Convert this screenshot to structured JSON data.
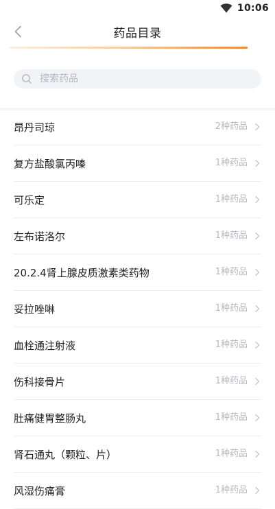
{
  "status_bar": {
    "time": "10:06",
    "icons": [
      "wifi-icon"
    ]
  },
  "header": {
    "title": "药品目录",
    "back_icon": "chevron-left-icon"
  },
  "search": {
    "placeholder": "搜索药品",
    "value": "",
    "icon": "search-icon"
  },
  "colors": {
    "accent": "#e98a3d",
    "muted_text": "#b7b9bf",
    "search_bg": "#f2f3f7"
  },
  "list": {
    "items": [
      {
        "name": "昂丹司琼",
        "count": "2种药品"
      },
      {
        "name": "复方盐酸氯丙嗪",
        "count": "1种药品"
      },
      {
        "name": "可乐定",
        "count": "1种药品"
      },
      {
        "name": "左布诺洛尔",
        "count": "1种药品"
      },
      {
        "name": "20.2.4肾上腺皮质激素类药物",
        "count": "1种药品"
      },
      {
        "name": "妥拉唑啉",
        "count": "1种药品"
      },
      {
        "name": "血栓通注射液",
        "count": "1种药品"
      },
      {
        "name": "伤科接骨片",
        "count": "1种药品"
      },
      {
        "name": "肚痛健胃整肠丸",
        "count": "1种药品"
      },
      {
        "name": "肾石通丸（颗粒、片）",
        "count": "1种药品"
      },
      {
        "name": "风湿伤痛膏",
        "count": "1种药品"
      }
    ]
  }
}
